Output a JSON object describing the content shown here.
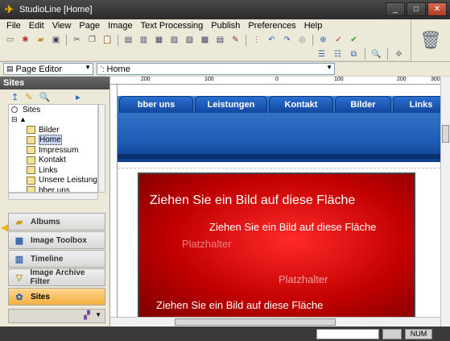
{
  "window": {
    "title": "StudioLine [Home]"
  },
  "menu": [
    "File",
    "Edit",
    "View",
    "Page",
    "Image",
    "Text Processing",
    "Publish",
    "Preferences",
    "Help"
  ],
  "address": {
    "view_select": "Page Editor",
    "page_path": "Home"
  },
  "sidebar": {
    "title": "Sites",
    "tree_root": "Sites",
    "tree_items": [
      "Bilder",
      "Home",
      "Impressum",
      "Kontakt",
      "Links",
      "Unsere Leistung",
      "bber uns"
    ],
    "selected": "Home",
    "panels": [
      {
        "label": "Albums",
        "icon": "albums-icon"
      },
      {
        "label": "Image Toolbox",
        "icon": "image-toolbox-icon"
      },
      {
        "label": "Timeline",
        "icon": "timeline-icon"
      },
      {
        "label": "Image Archive Filter",
        "icon": "archive-filter-icon"
      },
      {
        "label": "Sites",
        "icon": "sites-icon"
      }
    ]
  },
  "ruler": {
    "labels": [
      "200",
      "100",
      "0",
      "100",
      "200",
      "300"
    ]
  },
  "editor": {
    "nav_tabs": [
      "bber uns",
      "Leistungen",
      "Kontakt",
      "Bilder",
      "Links"
    ],
    "drop_text_1": "Ziehen Sie ein Bild auf diese Fläche",
    "drop_text_2": "Ziehen Sie ein Bild auf diese Fläche",
    "drop_text_3": "Ziehen Sie ein Bild auf diese Fläche",
    "placeholder_1": "Platzhalter",
    "placeholder_2": "Platzhalter"
  },
  "status": {
    "num": "NUM"
  },
  "colors": {
    "accent": "#f5b040",
    "nav_blue": "#1d5cb5",
    "red_fill": "#d00000"
  }
}
